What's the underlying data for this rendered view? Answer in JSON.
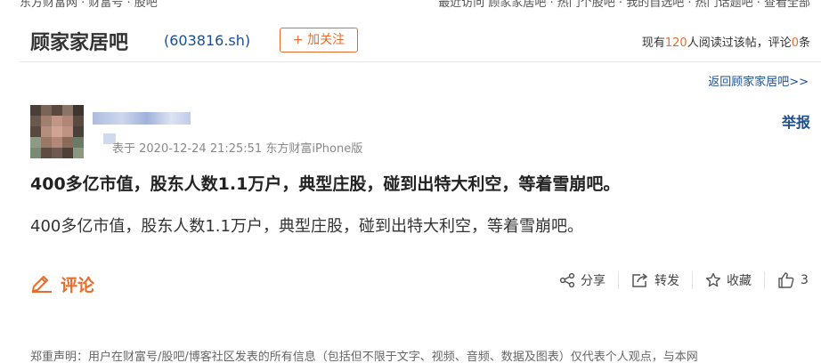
{
  "topbar": {
    "left_text": "东方财富网  ·  财富号  ·  股吧",
    "right_text": "最近访问  顾家家居吧  ·  热门个股吧  ·  我的自选吧  ·  热门话题吧  ·  查看全部"
  },
  "header": {
    "bar_name": "顾家家居吧",
    "stock_code": "(603816.sh)",
    "follow_label": "+ 加关注",
    "stats_prefix": "现有",
    "reading_count": "120",
    "stats_middle": "人阅读过该帖，评论",
    "comment_count": "0",
    "stats_suffix": "条"
  },
  "back_link": "返回顾家家居吧>>",
  "post": {
    "report_label": "举报",
    "meta": "表于 2020-12-24 21:25:51 东方财富iPhone版",
    "title": "400多亿市值，股东人数1.1万户，典型庄股，碰到出特大利空，等着雪崩吧。",
    "body": "400多亿市值，股东人数1.1万户，典型庄股，碰到出特大利空，等着雪崩吧。"
  },
  "comments": {
    "label": "评论",
    "icon": "pencil-icon"
  },
  "actions": [
    {
      "label": "分享",
      "icon": "share-icon"
    },
    {
      "label": "转发",
      "icon": "forward-icon"
    },
    {
      "label": "收藏",
      "icon": "star-icon"
    },
    {
      "label": "3",
      "icon": "thumbs-up-icon"
    }
  ],
  "disclaimer": "郑重声明：用户在财富号/股吧/博客社区发表的所有信息（包括但不限于文字、视频、音频、数据及图表）仅代表个人观点，与本网",
  "colors": {
    "accent": "#e86c2b",
    "link": "#1e4e8c"
  }
}
